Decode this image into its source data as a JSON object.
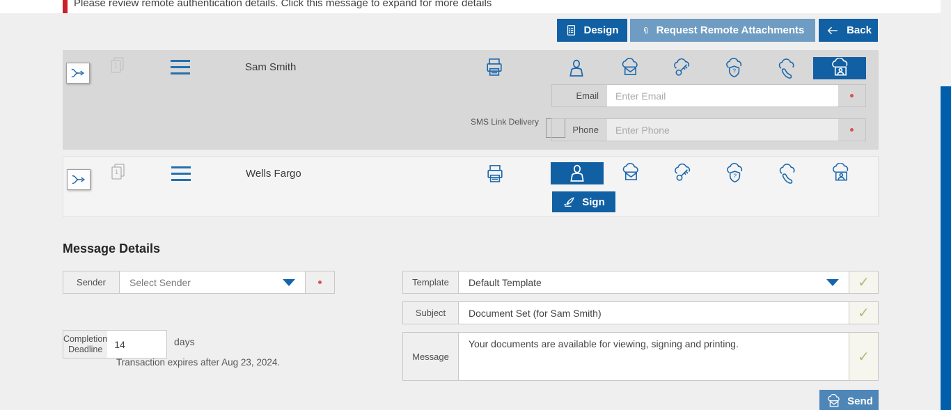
{
  "alert": {
    "text": "Please review remote authentication details. Click this message to expand for more details"
  },
  "toolbar": {
    "design_label": "Design",
    "request_remote_attachments_label": "Request Remote Attachments",
    "back_label": "Back"
  },
  "parties": [
    {
      "name": "Sam Smith",
      "document_count": "1",
      "selected_delivery": "remote-kiosk",
      "email": {
        "label": "Email",
        "placeholder": "Enter Email",
        "value": ""
      },
      "phone": {
        "label": "Phone",
        "placeholder": "Enter Phone",
        "value": ""
      },
      "sms_label": "SMS Link Delivery",
      "sms_checked": false
    },
    {
      "name": "Wells Fargo",
      "document_count": "1",
      "selected_delivery": "in-person",
      "sign_label": "Sign"
    }
  ],
  "message_details": {
    "title": "Message Details",
    "sender": {
      "label": "Sender",
      "placeholder": "Select Sender"
    },
    "completion_deadline": {
      "label": "Completion Deadline",
      "value": "14",
      "unit": "days",
      "note": "Transaction expires after Aug 23, 2024."
    },
    "template": {
      "label": "Template",
      "value": "Default Template"
    },
    "subject": {
      "label": "Subject",
      "value": "Document Set (for Sam Smith)"
    },
    "message": {
      "label": "Message",
      "value": "Your documents are available for viewing, signing and printing."
    },
    "send_label": "Send"
  },
  "icons": {
    "check_glyph": "✓",
    "names": [
      "route-merge",
      "document-pages",
      "drag-handle",
      "printer",
      "in-person-user",
      "cloud-email",
      "cloud-key",
      "cloud-question-shield",
      "cloud-phone",
      "cloud-kiosk-user",
      "design-document",
      "paperclip",
      "back-arrow",
      "quill-pen",
      "cloud-send-mail",
      "dropdown-caret",
      "required-dot"
    ]
  },
  "colors": {
    "accent_blue": "#1160a4",
    "mid_blue": "#6f9cc2",
    "send_blue": "#4e86b8",
    "alert_red": "#cb2027",
    "check_green": "#a3bf7c",
    "scrollbar_blue": "#005fad",
    "row1_bg": "#d8d8d8",
    "row2_bg": "#f4f4f4"
  }
}
